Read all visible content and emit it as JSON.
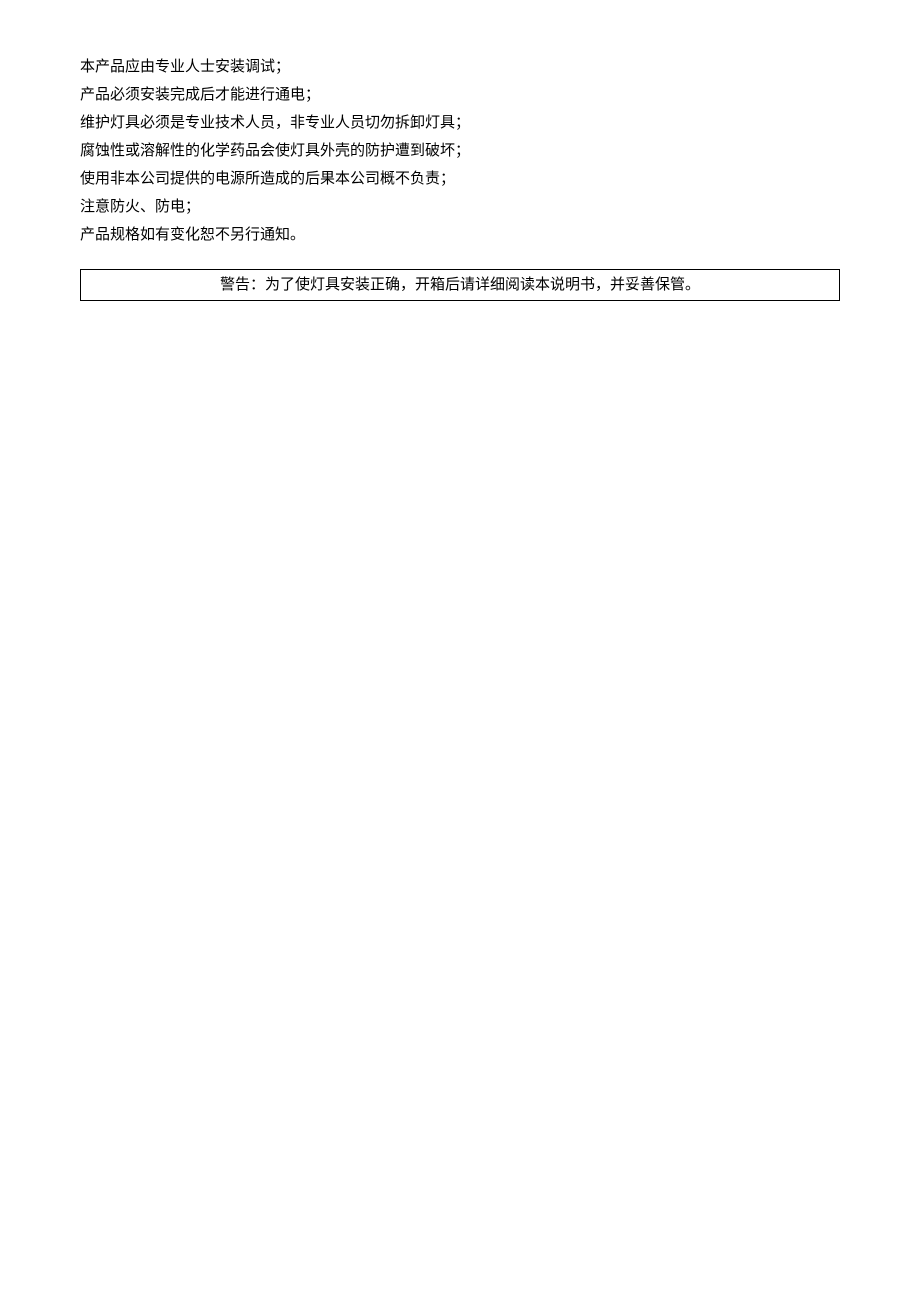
{
  "instructions": {
    "items": [
      "本产品应由专业人士安装调试；",
      "产品必须安装完成后才能进行通电；",
      "维护灯具必须是专业技术人员，非专业人员切勿拆卸灯具；",
      "腐蚀性或溶解性的化学药品会使灯具外壳的防护遭到破坏；",
      "使用非本公司提供的电源所造成的后果本公司概不负责；",
      "注意防火、防电；",
      "产品规格如有变化恕不另行通知。"
    ]
  },
  "warning": {
    "text": "警告：为了使灯具安装正确，开箱后请详细阅读本说明书，并妥善保管。"
  }
}
